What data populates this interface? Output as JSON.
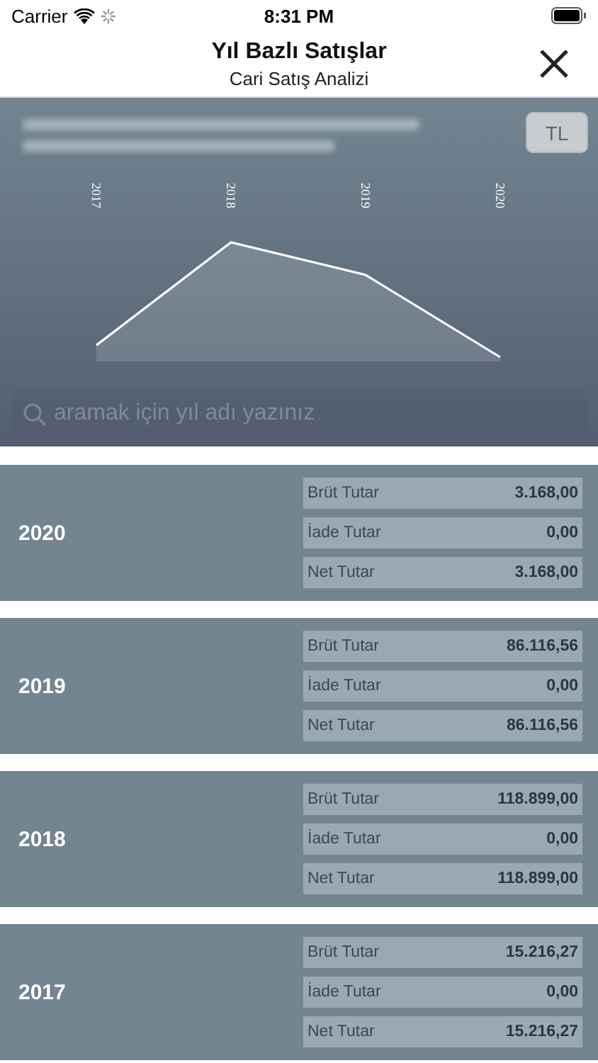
{
  "status_bar": {
    "carrier": "Carrier",
    "time": "8:31 PM"
  },
  "nav": {
    "title": "Yıl Bazlı Satışlar",
    "subtitle": "Cari Satış Analizi"
  },
  "currency_button": "TL",
  "chart_labels": [
    "2017",
    "2018",
    "2019",
    "2020"
  ],
  "search": {
    "placeholder": "aramak için yıl adı yazınız"
  },
  "years": [
    {
      "year": "2020",
      "rows": [
        {
          "label": "Brüt Tutar",
          "value": "3.168,00"
        },
        {
          "label": "İade Tutar",
          "value": "0,00"
        },
        {
          "label": "Net Tutar",
          "value": "3.168,00"
        }
      ]
    },
    {
      "year": "2019",
      "rows": [
        {
          "label": "Brüt Tutar",
          "value": "86.116,56"
        },
        {
          "label": "İade Tutar",
          "value": "0,00"
        },
        {
          "label": "Net Tutar",
          "value": "86.116,56"
        }
      ]
    },
    {
      "year": "2018",
      "rows": [
        {
          "label": "Brüt Tutar",
          "value": "118.899,00"
        },
        {
          "label": "İade Tutar",
          "value": "0,00"
        },
        {
          "label": "Net Tutar",
          "value": "118.899,00"
        }
      ]
    },
    {
      "year": "2017",
      "rows": [
        {
          "label": "Brüt Tutar",
          "value": "15.216,27"
        },
        {
          "label": "İade Tutar",
          "value": "0,00"
        },
        {
          "label": "Net Tutar",
          "value": "15.216,27"
        }
      ]
    }
  ]
}
